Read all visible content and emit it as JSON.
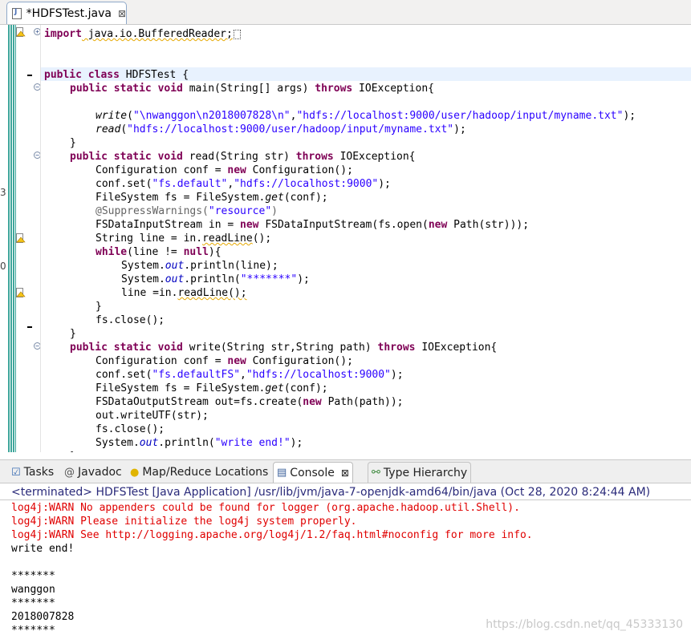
{
  "editor_tab": {
    "title": "*HDFSTest.java",
    "close": "⊠"
  },
  "code": {
    "import_kw": "import",
    "import_rest": " java.io.BufferedReader;",
    "l_class_a": "public class",
    "l_class_b": " HDFSTest {",
    "l_main_kw1": "public static void",
    "l_main_mid": " main(String[] args) ",
    "l_main_kw2": "throws",
    "l_main_end": " IOException{",
    "l_write_fn": "write",
    "l_write_s1": "\"\\nwanggon\\n2018007828\\n\"",
    "l_write_comma": ",",
    "l_write_s2": "\"hdfs://localhost:9000/user/hadoop/input/myname.txt\"",
    "l_write_end": ");",
    "l_read_fn": "read",
    "l_read_s": "\"hdfs://localhost:9000/user/hadoop/input/myname.txt\"",
    "l_read_end": ");",
    "close_brace": "}",
    "r_kw1": "public static void",
    "r_mid": " read(String str) ",
    "r_kw2": "throws",
    "r_end": " IOException{",
    "r_conf_a": "Configuration conf = ",
    "kw_new": "new",
    "r_conf_b": " Configuration();",
    "r_set_a": "conf.set(",
    "r_set_s1": "\"fs.default\"",
    "r_set_s2": "\"hdfs://localhost:9000\"",
    "r_fs_a": "FileSystem fs = FileSystem.",
    "r_fs_get": "get",
    "r_fs_b": "(conf);",
    "r_ann": "@SuppressWarnings(",
    "r_ann_s": "\"resource\"",
    "r_ann_end": ")",
    "r_in_a": "FSDataInputStream in = ",
    "r_in_b": " FSDataInputStream(fs.open(",
    "r_in_c": " Path(str)));",
    "r_line_a": "String line = in.",
    "r_readline": "readLine",
    "r_line_b": "();",
    "kw_while": "while",
    "r_while_mid": "(line != ",
    "kw_null": "null",
    "r_while_end": "){",
    "sys_a": "System.",
    "sys_out": "out",
    "r_p1_b": ".println(line);",
    "r_p2_b": ".println(",
    "r_p2_s": "\"*******\"",
    "r_reline_a": "line =in.",
    "r_reline_b": "();",
    "r_fsclose": "fs.close();",
    "w_kw1": "public static void",
    "w_mid": " write(String str,String path) ",
    "w_kw2": "throws",
    "w_end": " IOException{",
    "w_set_s1": "\"fs.defaultFS\"",
    "w_set_s2": "\"hdfs://localhost:9000\"",
    "w_out_a": "FSDataOutputStream out=fs.create(",
    "w_out_b": " Path(path));",
    "w_utf": "out.writeUTF(str);",
    "w_fsclose": "fs.close();",
    "w_p_b": ".println(",
    "w_p_s": "\"write end!\"",
    "w_p_end": ");",
    "comma": ",",
    "set_end": ");"
  },
  "panel_tabs": [
    {
      "label": "Tasks",
      "icon": "tasks-icon"
    },
    {
      "label": "Javadoc",
      "icon": "at-icon"
    },
    {
      "label": "Map/Reduce Locations",
      "icon": "elephant-icon"
    },
    {
      "label": "Console",
      "icon": "console-icon",
      "close": "⊠"
    },
    {
      "label": "Type Hierarchy",
      "icon": "hierarchy-icon"
    }
  ],
  "console": {
    "header": "<terminated> HDFSTest [Java Application] /usr/lib/jvm/java-7-openjdk-amd64/bin/java (Oct 28, 2020 8:24:44 AM)",
    "lines": [
      "log4j:WARN No appenders could be found for logger (org.apache.hadoop.util.Shell).",
      "log4j:WARN Please initialize the log4j system properly.",
      "log4j:WARN See http://logging.apache.org/log4j/1.2/faq.html#noconfig for more info.",
      "write end!",
      "",
      "*******",
      "wanggon",
      "*******",
      "2018007828",
      "*******"
    ]
  },
  "watermark": "https://blog.csdn.net/qq_45333130",
  "edge_marks": [
    "3",
    "0"
  ],
  "colors": {
    "keyword": "#7f0055",
    "string": "#2a00ff",
    "annotation": "#646464",
    "console_error": "#e00000",
    "console_header": "#2a2a7a"
  }
}
